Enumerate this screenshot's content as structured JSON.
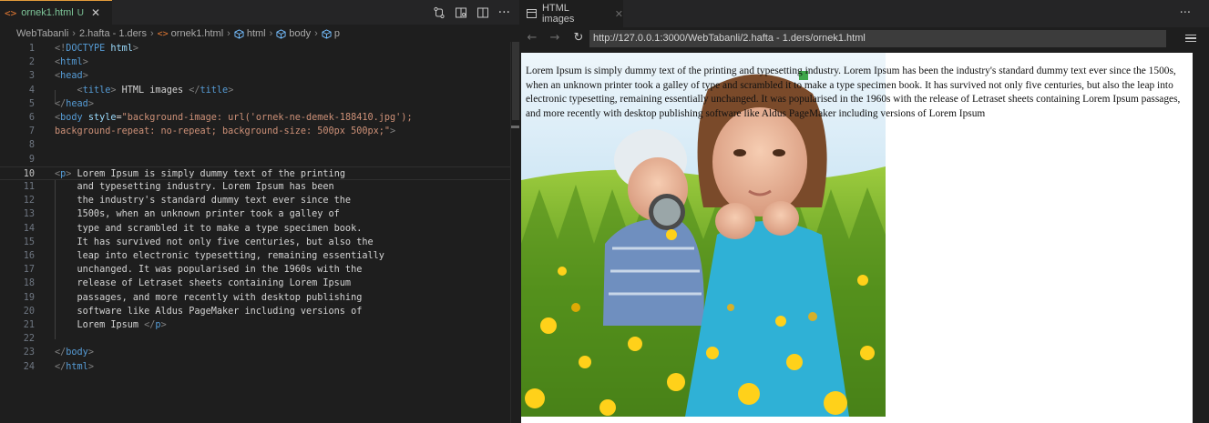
{
  "editor": {
    "tab": {
      "file_icon": "<>",
      "name": "ornek1.html",
      "status": "U",
      "close": "✕"
    },
    "breadcrumb": [
      "WebTabanli",
      "2.hafta - 1.ders",
      "ornek1.html",
      "html",
      "body",
      "p"
    ],
    "actions": [
      "compare-changes-icon",
      "open-preview-icon",
      "split-editor-icon",
      "more-actions-icon"
    ],
    "more_label": "···",
    "active_line": 10,
    "lines": [
      {
        "n": "1",
        "html": "<span class='tag'>&lt;!</span><span class='tn'>DOCTYPE</span> <span class='an'>html</span><span class='tag'>&gt;</span>"
      },
      {
        "n": "2",
        "html": "<span class='tag'>&lt;</span><span class='tn'>html</span><span class='tag'>&gt;</span>"
      },
      {
        "n": "3",
        "html": "<span class='tag'>&lt;</span><span class='tn'>head</span><span class='tag'>&gt;</span>"
      },
      {
        "n": "4",
        "html": "    <span class='tag'>&lt;</span><span class='tn'>title</span><span class='tag'>&gt;</span><span class='tx'> HTML images </span><span class='tag'>&lt;/</span><span class='tn'>title</span><span class='tag'>&gt;</span>"
      },
      {
        "n": "5",
        "html": "<span class='tag'>&lt;/</span><span class='tn'>head</span><span class='tag'>&gt;</span>"
      },
      {
        "n": "6",
        "html": "<span class='tag'>&lt;</span><span class='tn'>body</span> <span class='an'>style</span><span class='tx'>=</span><span class='av'>\"background-image: url('ornek-ne-demek-188410.jpg');</span>"
      },
      {
        "n": "7",
        "html": "<span class='av'>background-repeat: no-repeat; background-size: 500px 500px;\"</span><span class='tag'>&gt;</span>"
      },
      {
        "n": "8",
        "html": ""
      },
      {
        "n": "9",
        "html": ""
      },
      {
        "n": "10",
        "html": "<span class='tag'>&lt;</span><span class='tn'>p</span><span class='tag'>&gt;</span><span class='tx'> Lorem Ipsum is simply dummy text of the printing</span>"
      },
      {
        "n": "11",
        "html": "<span class='tx'>    and typesetting industry. Lorem Ipsum has been</span>"
      },
      {
        "n": "12",
        "html": "<span class='tx'>    the industry's standard dummy text ever since the</span>"
      },
      {
        "n": "13",
        "html": "<span class='tx'>    1500s, when an unknown printer took a galley of</span>"
      },
      {
        "n": "14",
        "html": "<span class='tx'>    type and scrambled it to make a type specimen book.</span>"
      },
      {
        "n": "15",
        "html": "<span class='tx'>    It has survived not only five centuries, but also the</span>"
      },
      {
        "n": "16",
        "html": "<span class='tx'>    leap into electronic typesetting, remaining essentially</span>"
      },
      {
        "n": "17",
        "html": "<span class='tx'>    unchanged. It was popularised in the 1960s with the</span>"
      },
      {
        "n": "18",
        "html": "<span class='tx'>    release of Letraset sheets containing Lorem Ipsum</span>"
      },
      {
        "n": "19",
        "html": "<span class='tx'>    passages, and more recently with desktop publishing</span>"
      },
      {
        "n": "20",
        "html": "<span class='tx'>    software like Aldus PageMaker including versions of</span>"
      },
      {
        "n": "21",
        "html": "<span class='tx'>    Lorem Ipsum </span><span class='tag'>&lt;/</span><span class='tn'>p</span><span class='tag'>&gt;</span>"
      },
      {
        "n": "22",
        "html": ""
      },
      {
        "n": "23",
        "html": "<span class='tag'>&lt;/</span><span class='tn'>body</span><span class='tag'>&gt;</span>"
      },
      {
        "n": "24",
        "html": "<span class='tag'>&lt;/</span><span class='tn'>html</span><span class='tag'>&gt;</span>"
      }
    ]
  },
  "preview": {
    "tab_title": "HTML images",
    "tab_close": "✕",
    "more_label": "···",
    "back": "←",
    "forward": "→",
    "reload": "↻",
    "url": "http://127.0.0.1:3000/WebTabanli/2.hafta - 1.ders/ornek1.html",
    "paragraph": "Lorem Ipsum is simply dummy text of the printing and typesetting industry. Lorem Ipsum has been the industry's standard dummy text ever since the 1500s, when an unknown printer took a galley of type and scrambled it to make a type specimen book. It has survived not only five centuries, but also the leap into electronic typesetting, remaining essentially unchanged. It was popularised in the 1960s with the release of Letraset sheets containing Lorem Ipsum passages, and more recently with desktop publishing software like Aldus PageMaker including versions of Lorem Ipsum"
  },
  "colors": {
    "accent_tab_border": "#e39b3a",
    "modified_file": "#7ec699",
    "keyword": "#569cd6",
    "attribute": "#9cdcfe",
    "string": "#ce9178"
  }
}
